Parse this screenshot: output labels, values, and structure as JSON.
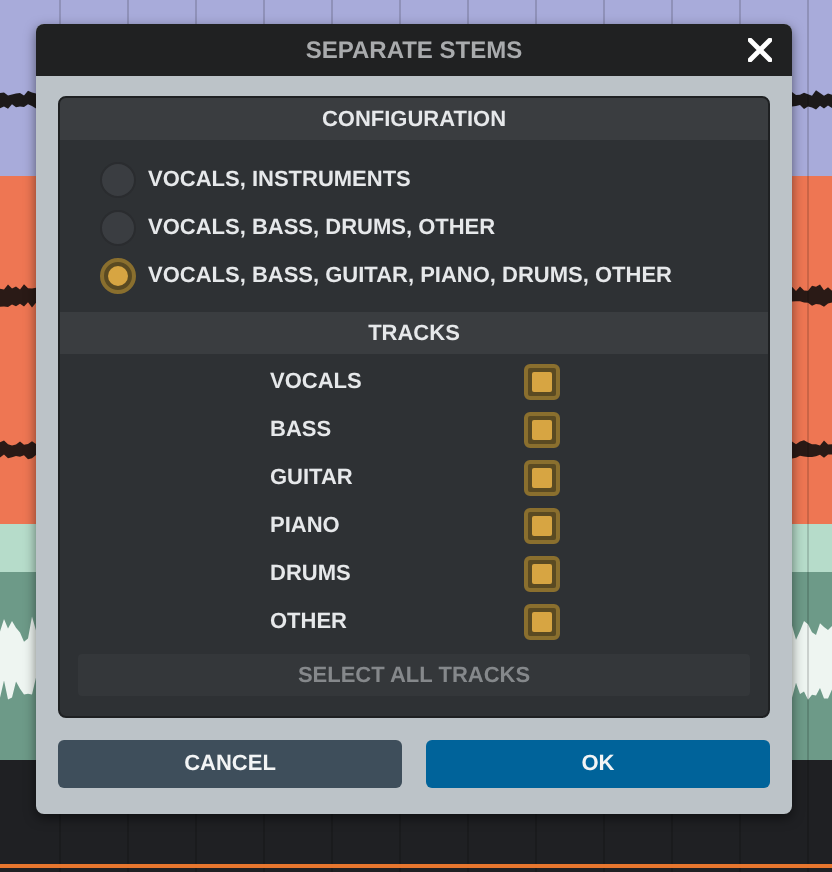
{
  "dialog": {
    "title": "SEPARATE STEMS"
  },
  "configuration": {
    "heading": "CONFIGURATION",
    "options": [
      {
        "label": "VOCALS, INSTRUMENTS",
        "selected": false
      },
      {
        "label": "VOCALS, BASS, DRUMS, OTHER",
        "selected": false
      },
      {
        "label": "VOCALS, BASS, GUITAR, PIANO, DRUMS, OTHER",
        "selected": true
      }
    ]
  },
  "tracks": {
    "heading": "TRACKS",
    "items": [
      {
        "label": "VOCALS",
        "checked": true
      },
      {
        "label": "BASS",
        "checked": true
      },
      {
        "label": "GUITAR",
        "checked": true
      },
      {
        "label": "PIANO",
        "checked": true
      },
      {
        "label": "DRUMS",
        "checked": true
      },
      {
        "label": "OTHER",
        "checked": true
      }
    ],
    "select_all": {
      "label": "SELECT ALL TRACKS",
      "disabled": true
    }
  },
  "buttons": [
    {
      "label": "CANCEL",
      "kind": "secondary"
    },
    {
      "label": "OK",
      "kind": "primary"
    }
  ]
}
